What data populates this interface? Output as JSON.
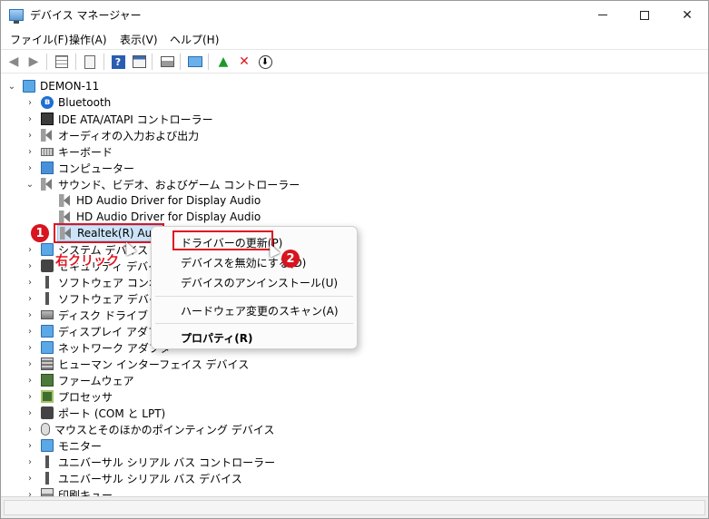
{
  "window": {
    "title": "デバイス マネージャー"
  },
  "menu": [
    "ファイル(F)",
    "操作(A)",
    "表示(V)",
    "ヘルプ(H)"
  ],
  "tree": {
    "root": "DEMON-11",
    "items": [
      {
        "label": "Bluetooth",
        "icon": "bluetooth-icon"
      },
      {
        "label": "IDE ATA/ATAPI コントローラー",
        "icon": "ide-controller-icon"
      },
      {
        "label": "オーディオの入力および出力",
        "icon": "speaker-icon"
      },
      {
        "label": "キーボード",
        "icon": "keyboard-icon"
      },
      {
        "label": "コンピューター",
        "icon": "computer-icon"
      },
      {
        "label": "サウンド、ビデオ、およびゲーム コントローラー",
        "icon": "speaker-icon"
      },
      {
        "label": "HD Audio Driver for Display Audio",
        "icon": "speaker-icon"
      },
      {
        "label": "HD Audio Driver for Display Audio",
        "icon": "speaker-icon"
      },
      {
        "label": "Realtek(R) Audio",
        "icon": "speaker-icon"
      },
      {
        "label": "システム デバイス",
        "icon": "system-devices-icon"
      },
      {
        "label": "セキュリティ デバイス",
        "icon": "security-device-icon"
      },
      {
        "label": "ソフトウェア コンポーネント",
        "icon": "software-component-icon"
      },
      {
        "label": "ソフトウェア デバイス",
        "icon": "software-device-icon"
      },
      {
        "label": "ディスク ドライブ",
        "icon": "disk-drive-icon"
      },
      {
        "label": "ディスプレイ アダプター",
        "icon": "display-adapter-icon"
      },
      {
        "label": "ネットワーク アダプター",
        "icon": "network-adapter-icon"
      },
      {
        "label": "ヒューマン インターフェイス デバイス",
        "icon": "hid-icon"
      },
      {
        "label": "ファームウェア",
        "icon": "firmware-icon"
      },
      {
        "label": "プロセッサ",
        "icon": "processor-icon"
      },
      {
        "label": "ポート (COM と LPT)",
        "icon": "port-icon"
      },
      {
        "label": "マウスとそのほかのポインティング デバイス",
        "icon": "mouse-icon"
      },
      {
        "label": "モニター",
        "icon": "monitor-icon"
      },
      {
        "label": "ユニバーサル シリアル バス コントローラー",
        "icon": "usb-icon"
      },
      {
        "label": "ユニバーサル シリアル バス デバイス",
        "icon": "usb-icon"
      },
      {
        "label": "印刷キュー",
        "icon": "printer-icon"
      }
    ]
  },
  "context_menu": {
    "update_driver": "ドライバーの更新(P)",
    "disable_device": "デバイスを無効にする(D)",
    "uninstall_device": "デバイスのアンインストール(U)",
    "scan_hardware": "ハードウェア変更のスキャン(A)",
    "properties": "プロパティ(R)"
  },
  "annotations": {
    "step1": "1",
    "step2": "2",
    "right_click": "右クリック",
    "accent_color": "#e0141e"
  }
}
